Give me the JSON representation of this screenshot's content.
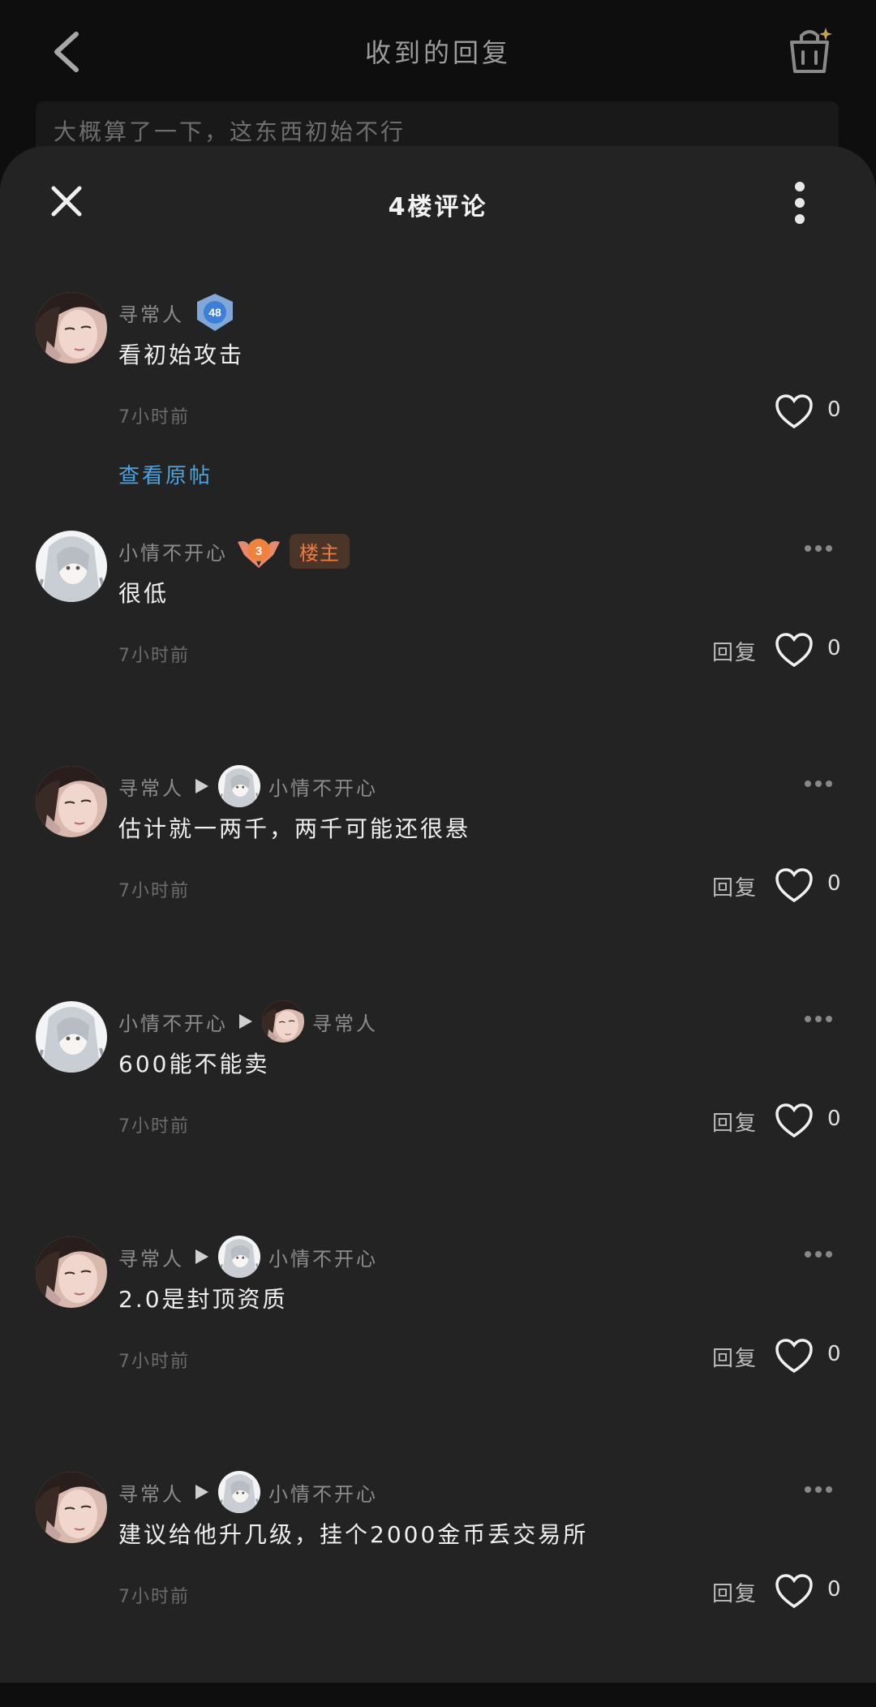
{
  "header": {
    "title": "收到的回复",
    "preview_text": "大概算了一下，这东西初始不行"
  },
  "sheet": {
    "title": "4楼评论"
  },
  "comments": [
    {
      "user": "寻常人",
      "level": "48",
      "text": "看初始攻击",
      "time": "7小时前",
      "likes": "0",
      "view_original": "查看原帖"
    },
    {
      "user": "小情不开心",
      "level": "3",
      "owner_tag": "楼主",
      "text": "很低",
      "time": "7小时前",
      "reply": "回复",
      "likes": "0"
    },
    {
      "user": "寻常人",
      "reply_to": "小情不开心",
      "text": "估计就一两千，两千可能还很悬",
      "time": "7小时前",
      "reply": "回复",
      "likes": "0"
    },
    {
      "user": "小情不开心",
      "reply_to": "寻常人",
      "text": "600能不能卖",
      "time": "7小时前",
      "reply": "回复",
      "likes": "0"
    },
    {
      "user": "寻常人",
      "reply_to": "小情不开心",
      "text": "2.0是封顶资质",
      "time": "7小时前",
      "reply": "回复",
      "likes": "0"
    },
    {
      "user": "寻常人",
      "reply_to": "小情不开心",
      "text": "建议给他升几级，挂个2000金币丢交易所",
      "time": "7小时前",
      "reply": "回复",
      "likes": "0"
    }
  ],
  "colors": {
    "sheet_bg": "#232323",
    "link": "#4aa3df",
    "owner_tag": "#f07b3f"
  }
}
